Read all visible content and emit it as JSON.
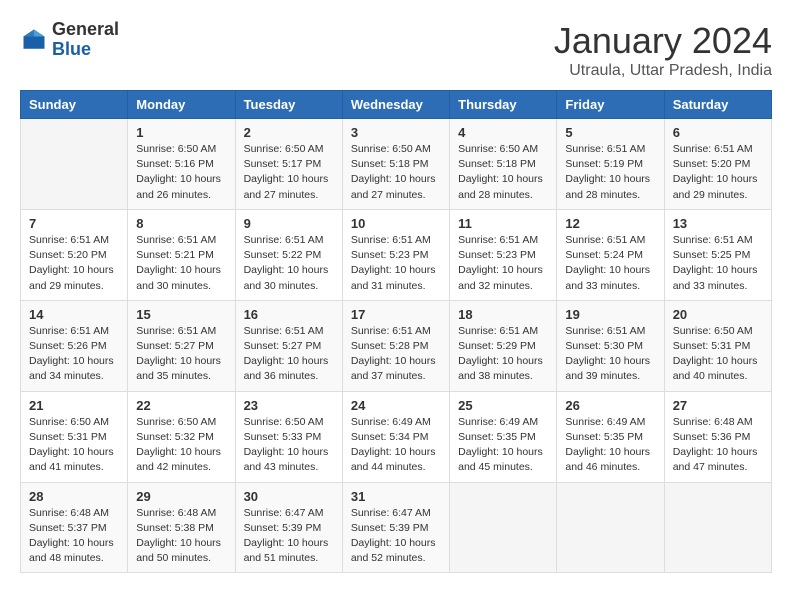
{
  "header": {
    "logo_general": "General",
    "logo_blue": "Blue",
    "month_year": "January 2024",
    "location": "Utraula, Uttar Pradesh, India"
  },
  "columns": [
    "Sunday",
    "Monday",
    "Tuesday",
    "Wednesday",
    "Thursday",
    "Friday",
    "Saturday"
  ],
  "weeks": [
    [
      {
        "day": "",
        "info": ""
      },
      {
        "day": "1",
        "info": "Sunrise: 6:50 AM\nSunset: 5:16 PM\nDaylight: 10 hours\nand 26 minutes."
      },
      {
        "day": "2",
        "info": "Sunrise: 6:50 AM\nSunset: 5:17 PM\nDaylight: 10 hours\nand 27 minutes."
      },
      {
        "day": "3",
        "info": "Sunrise: 6:50 AM\nSunset: 5:18 PM\nDaylight: 10 hours\nand 27 minutes."
      },
      {
        "day": "4",
        "info": "Sunrise: 6:50 AM\nSunset: 5:18 PM\nDaylight: 10 hours\nand 28 minutes."
      },
      {
        "day": "5",
        "info": "Sunrise: 6:51 AM\nSunset: 5:19 PM\nDaylight: 10 hours\nand 28 minutes."
      },
      {
        "day": "6",
        "info": "Sunrise: 6:51 AM\nSunset: 5:20 PM\nDaylight: 10 hours\nand 29 minutes."
      }
    ],
    [
      {
        "day": "7",
        "info": "Sunrise: 6:51 AM\nSunset: 5:20 PM\nDaylight: 10 hours\nand 29 minutes."
      },
      {
        "day": "8",
        "info": "Sunrise: 6:51 AM\nSunset: 5:21 PM\nDaylight: 10 hours\nand 30 minutes."
      },
      {
        "day": "9",
        "info": "Sunrise: 6:51 AM\nSunset: 5:22 PM\nDaylight: 10 hours\nand 30 minutes."
      },
      {
        "day": "10",
        "info": "Sunrise: 6:51 AM\nSunset: 5:23 PM\nDaylight: 10 hours\nand 31 minutes."
      },
      {
        "day": "11",
        "info": "Sunrise: 6:51 AM\nSunset: 5:23 PM\nDaylight: 10 hours\nand 32 minutes."
      },
      {
        "day": "12",
        "info": "Sunrise: 6:51 AM\nSunset: 5:24 PM\nDaylight: 10 hours\nand 33 minutes."
      },
      {
        "day": "13",
        "info": "Sunrise: 6:51 AM\nSunset: 5:25 PM\nDaylight: 10 hours\nand 33 minutes."
      }
    ],
    [
      {
        "day": "14",
        "info": "Sunrise: 6:51 AM\nSunset: 5:26 PM\nDaylight: 10 hours\nand 34 minutes."
      },
      {
        "day": "15",
        "info": "Sunrise: 6:51 AM\nSunset: 5:27 PM\nDaylight: 10 hours\nand 35 minutes."
      },
      {
        "day": "16",
        "info": "Sunrise: 6:51 AM\nSunset: 5:27 PM\nDaylight: 10 hours\nand 36 minutes."
      },
      {
        "day": "17",
        "info": "Sunrise: 6:51 AM\nSunset: 5:28 PM\nDaylight: 10 hours\nand 37 minutes."
      },
      {
        "day": "18",
        "info": "Sunrise: 6:51 AM\nSunset: 5:29 PM\nDaylight: 10 hours\nand 38 minutes."
      },
      {
        "day": "19",
        "info": "Sunrise: 6:51 AM\nSunset: 5:30 PM\nDaylight: 10 hours\nand 39 minutes."
      },
      {
        "day": "20",
        "info": "Sunrise: 6:50 AM\nSunset: 5:31 PM\nDaylight: 10 hours\nand 40 minutes."
      }
    ],
    [
      {
        "day": "21",
        "info": "Sunrise: 6:50 AM\nSunset: 5:31 PM\nDaylight: 10 hours\nand 41 minutes."
      },
      {
        "day": "22",
        "info": "Sunrise: 6:50 AM\nSunset: 5:32 PM\nDaylight: 10 hours\nand 42 minutes."
      },
      {
        "day": "23",
        "info": "Sunrise: 6:50 AM\nSunset: 5:33 PM\nDaylight: 10 hours\nand 43 minutes."
      },
      {
        "day": "24",
        "info": "Sunrise: 6:49 AM\nSunset: 5:34 PM\nDaylight: 10 hours\nand 44 minutes."
      },
      {
        "day": "25",
        "info": "Sunrise: 6:49 AM\nSunset: 5:35 PM\nDaylight: 10 hours\nand 45 minutes."
      },
      {
        "day": "26",
        "info": "Sunrise: 6:49 AM\nSunset: 5:35 PM\nDaylight: 10 hours\nand 46 minutes."
      },
      {
        "day": "27",
        "info": "Sunrise: 6:48 AM\nSunset: 5:36 PM\nDaylight: 10 hours\nand 47 minutes."
      }
    ],
    [
      {
        "day": "28",
        "info": "Sunrise: 6:48 AM\nSunset: 5:37 PM\nDaylight: 10 hours\nand 48 minutes."
      },
      {
        "day": "29",
        "info": "Sunrise: 6:48 AM\nSunset: 5:38 PM\nDaylight: 10 hours\nand 50 minutes."
      },
      {
        "day": "30",
        "info": "Sunrise: 6:47 AM\nSunset: 5:39 PM\nDaylight: 10 hours\nand 51 minutes."
      },
      {
        "day": "31",
        "info": "Sunrise: 6:47 AM\nSunset: 5:39 PM\nDaylight: 10 hours\nand 52 minutes."
      },
      {
        "day": "",
        "info": ""
      },
      {
        "day": "",
        "info": ""
      },
      {
        "day": "",
        "info": ""
      }
    ]
  ]
}
